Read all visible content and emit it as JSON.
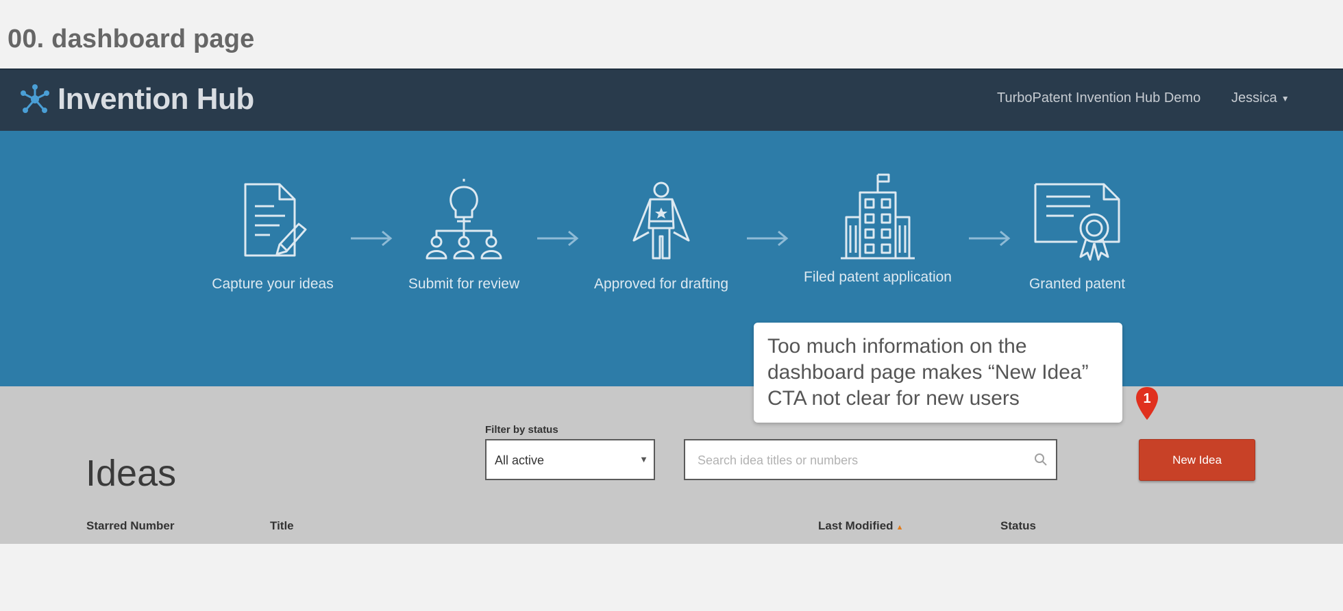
{
  "page_label": "00. dashboard page",
  "navbar": {
    "logo_text": "Invention Hub",
    "logo_icon": "network-star-icon",
    "demo_link": "TurboPatent Invention Hub Demo",
    "user_name": "Jessica",
    "user_caret": "▼"
  },
  "steps": [
    {
      "label": "Capture your ideas",
      "icon": "document-pencil-icon"
    },
    {
      "label": "Submit for review",
      "icon": "lightbulb-hierarchy-icon"
    },
    {
      "label": "Approved for drafting",
      "icon": "superhero-icon"
    },
    {
      "label": "Filed patent application",
      "icon": "office-building-icon"
    },
    {
      "label": "Granted patent",
      "icon": "certificate-icon"
    }
  ],
  "annotation": {
    "text": "Too much information on the dashboard page makes “New Idea” CTA not clear for new users",
    "marker_number": "1",
    "marker_color": "#e0301e"
  },
  "ideas": {
    "title": "Ideas",
    "filter_label": "Filter by status",
    "filter_value": "All active",
    "filter_caret": "▼",
    "search_placeholder": "Search idea titles or numbers",
    "new_idea_label": "New Idea",
    "columns": [
      "Starred Number",
      "Title",
      "Last Modified",
      "Status"
    ],
    "sort_indicator": "▲"
  },
  "colors": {
    "navbar": "#293b4c",
    "hero": "#2d7ca8",
    "panel": "#c8c8c8",
    "cta": "#c84127",
    "sort_accent": "#e07b1a"
  }
}
